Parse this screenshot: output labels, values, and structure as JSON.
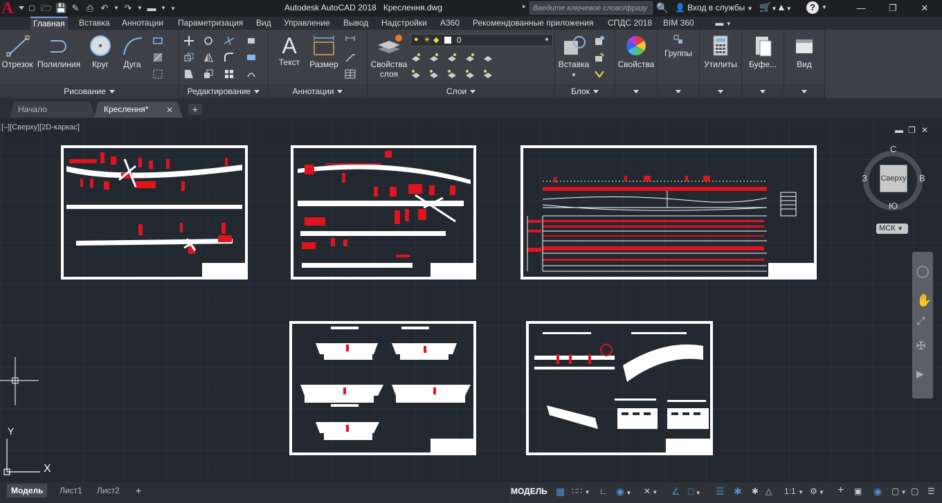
{
  "title_bar": {
    "logo": "A",
    "app_title": "Autodesk AutoCAD 2018",
    "file_name": "Креслення.dwg",
    "search_placeholder": "Введите ключевое слово/фразу",
    "sign_in": "Вход в службы",
    "help": "?",
    "quick_access_icons": [
      "new-icon",
      "open-icon",
      "save-icon",
      "save-as-icon",
      "print-icon",
      "undo-icon",
      "redo-icon",
      "workspace-icon"
    ]
  },
  "ribbon_tabs": [
    "Главная",
    "Вставка",
    "Аннотации",
    "Параметризация",
    "Вид",
    "Управление",
    "Вывод",
    "Надстройки",
    "A360",
    "Рекомендованные приложения",
    "СПДС 2018",
    "BIM 360"
  ],
  "active_tab": "Главная",
  "panels": {
    "draw": {
      "title": "Рисование",
      "tools": [
        "Отрезок",
        "Полилиния",
        "Круг",
        "Дуга"
      ]
    },
    "modify": {
      "title": "Редактирование"
    },
    "annotation": {
      "title": "Аннотации",
      "tools": [
        "Текст",
        "Размер"
      ]
    },
    "layers": {
      "title": "Слои",
      "tool": "Свойства слоя",
      "tool_line1": "Свойства",
      "tool_line2": "слоя",
      "current_layer": "0"
    },
    "block": {
      "title": "Блок",
      "tool": "Вставка"
    },
    "properties": {
      "tool": "Свойства"
    },
    "groups": {
      "tool": "Группы"
    },
    "utilities": {
      "tool": "Утилиты"
    },
    "clipboard": {
      "tool": "Буфе..."
    },
    "view": {
      "tool": "Вид"
    }
  },
  "doc_tabs": [
    "Начало",
    "Креслення*"
  ],
  "active_doc": "Креслення*",
  "viewport": {
    "label": "[–][Сверху][2D-каркас]",
    "viewcube": {
      "north": "С",
      "south": "Ю",
      "west": "З",
      "east": "В",
      "face": "Сверху"
    },
    "ucs": "МСК",
    "axis_x": "X",
    "axis_y": "Y"
  },
  "layout_tabs": [
    "Модель",
    "Лист1",
    "Лист2"
  ],
  "active_layout": "Модель",
  "status": {
    "model": "МОДЕЛЬ",
    "scale": "1:1"
  },
  "colors": {
    "accent": "#7aa5d8",
    "logo": "#c8102e",
    "sheet": "#ffffff",
    "drawing_red": "#e0141e",
    "canvas": "#212830"
  }
}
